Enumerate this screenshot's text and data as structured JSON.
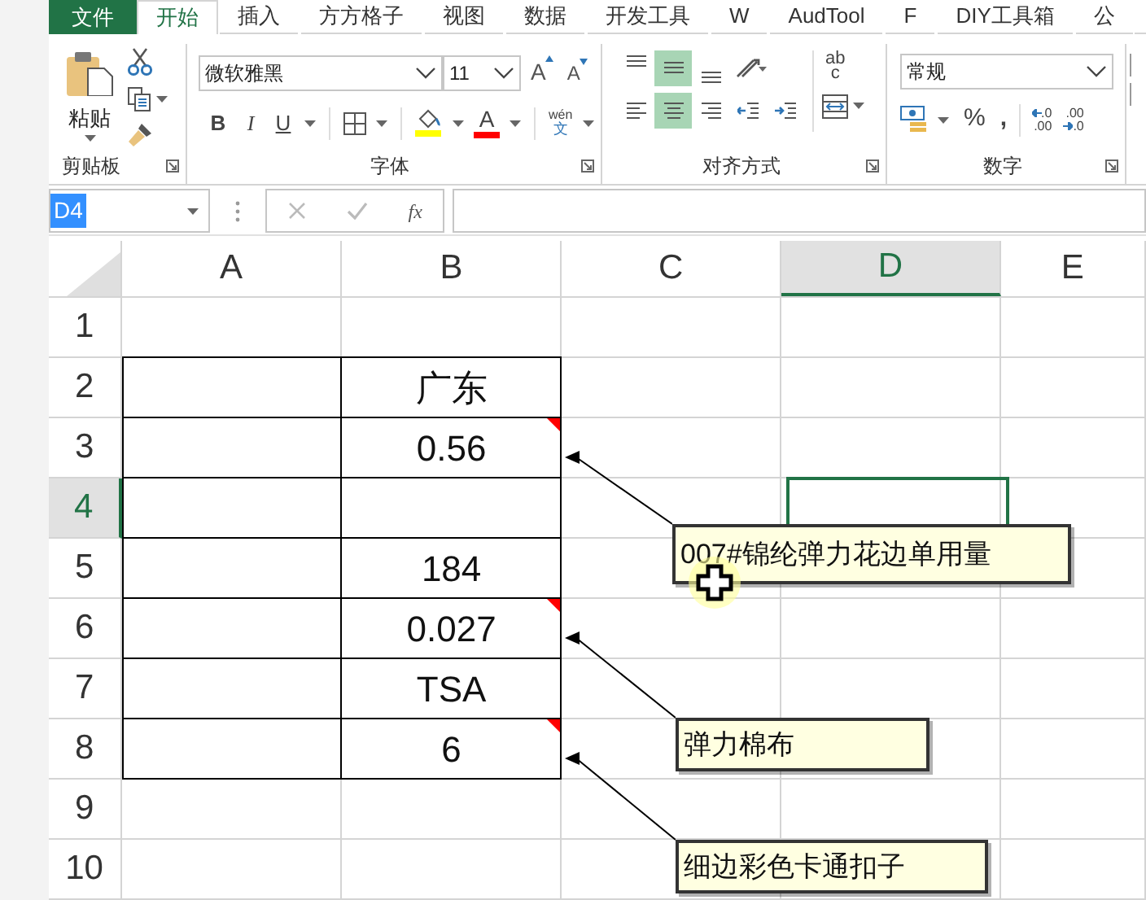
{
  "tabs": [
    {
      "label": "文件",
      "kind": "file",
      "selected": false
    },
    {
      "label": "开始",
      "kind": "tab",
      "selected": true
    },
    {
      "label": "插入",
      "kind": "tab",
      "selected": false
    },
    {
      "label": "方方格子",
      "kind": "tab",
      "selected": false
    },
    {
      "label": "视图",
      "kind": "tab",
      "selected": false
    },
    {
      "label": "数据",
      "kind": "tab",
      "selected": false
    },
    {
      "label": "开发工具",
      "kind": "tab",
      "selected": false
    },
    {
      "label": "W",
      "kind": "tab",
      "selected": false
    },
    {
      "label": "AudTool",
      "kind": "tab",
      "selected": false
    },
    {
      "label": "F",
      "kind": "tab",
      "selected": false
    },
    {
      "label": "DIY工具箱",
      "kind": "tab",
      "selected": false
    },
    {
      "label": "公",
      "kind": "tab",
      "selected": false
    }
  ],
  "clipboard": {
    "paste_label": "粘贴",
    "group_label": "剪贴板"
  },
  "font": {
    "name": "微软雅黑",
    "size": "11",
    "grow": "A",
    "shrink": "A",
    "style_buttons": [
      "B",
      "I",
      "U"
    ],
    "font_color_glyph": "A",
    "phonetic_top": "wén",
    "phonetic_bottom": "文",
    "group_label": "字体"
  },
  "alignment": {
    "buttons": [
      {
        "kind": "top",
        "selected": false
      },
      {
        "kind": "middle",
        "selected": true
      },
      {
        "kind": "bottom",
        "selected": false
      },
      {
        "kind": "orient",
        "selected": false
      },
      {
        "kind": "left",
        "selected": false
      },
      {
        "kind": "center",
        "selected": true
      },
      {
        "kind": "right",
        "selected": false
      },
      {
        "kind": "outdent",
        "selected": false
      },
      {
        "kind": "indent",
        "selected": false
      }
    ],
    "wrap_top": "ab",
    "wrap_bottom": "c",
    "group_label": "对齐方式"
  },
  "number": {
    "format": "常规",
    "percent": "%",
    "comma": ",",
    "increase_decimal": [
      ".0",
      ".00"
    ],
    "decrease_decimal": [
      ".00",
      ".0"
    ],
    "group_label": "数字"
  },
  "formula_bar": {
    "name_box": "D4",
    "fx": "fx"
  },
  "columns": [
    {
      "label": "A",
      "selected": false
    },
    {
      "label": "B",
      "selected": false
    },
    {
      "label": "C",
      "selected": false
    },
    {
      "label": "D",
      "selected": true
    },
    {
      "label": "E",
      "selected": false
    }
  ],
  "rows": [
    {
      "label": "1",
      "selected": false
    },
    {
      "label": "2",
      "selected": false,
      "column_b": {
        "value": "广东"
      }
    },
    {
      "label": "3",
      "selected": false,
      "column_b": {
        "value": "0.56",
        "comment": "007#锦纶弹力花边单用量"
      }
    },
    {
      "label": "4",
      "selected": true
    },
    {
      "label": "5",
      "selected": false,
      "column_b": {
        "value": "184"
      }
    },
    {
      "label": "6",
      "selected": false,
      "column_b": {
        "value": "0.027",
        "comment": "弹力棉布"
      }
    },
    {
      "label": "7",
      "selected": false,
      "column_b": {
        "value": "TSA"
      }
    },
    {
      "label": "8",
      "selected": false,
      "column_b": {
        "value": "6",
        "comment": "细边彩色卡通扣子"
      }
    },
    {
      "label": "9",
      "selected": false
    },
    {
      "label": "10",
      "selected": false
    }
  ]
}
